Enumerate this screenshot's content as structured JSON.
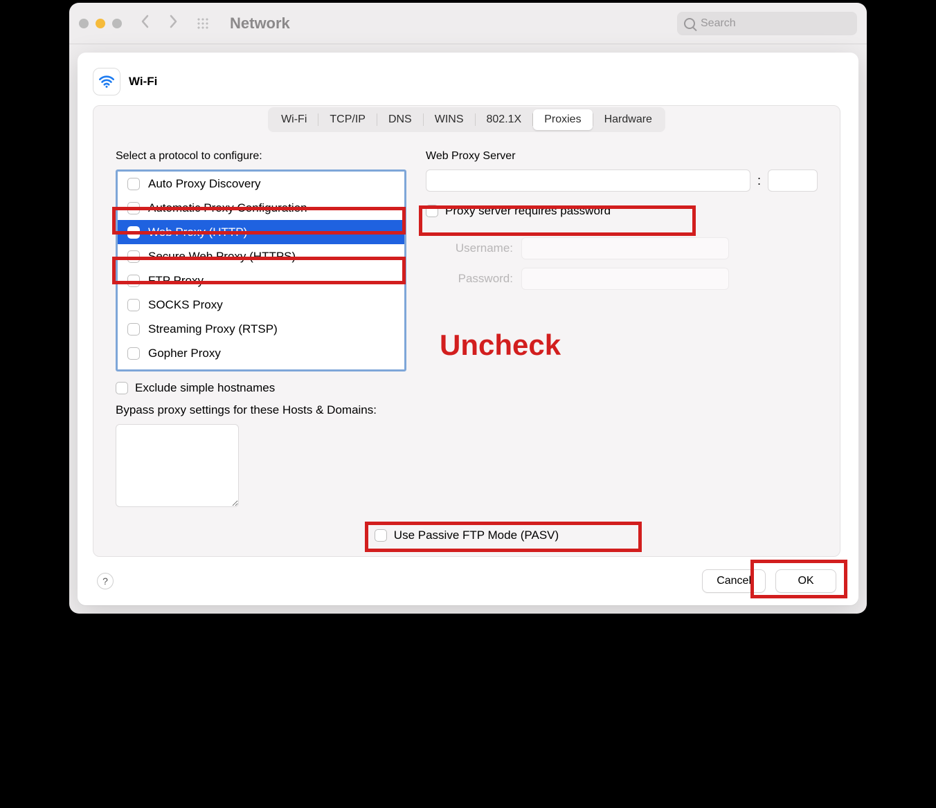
{
  "toolbar": {
    "title": "Network",
    "search_placeholder": "Search"
  },
  "sheet": {
    "title": "Wi-Fi",
    "tabs": [
      "Wi-Fi",
      "TCP/IP",
      "DNS",
      "WINS",
      "802.1X",
      "Proxies",
      "Hardware"
    ],
    "active_tab_index": 5
  },
  "left": {
    "label": "Select a protocol to configure:",
    "protocols": [
      {
        "label": "Auto Proxy Discovery",
        "checked": false,
        "selected": false
      },
      {
        "label": "Automatic Proxy Configuration",
        "checked": false,
        "selected": false
      },
      {
        "label": "Web Proxy (HTTP)",
        "checked": false,
        "selected": true
      },
      {
        "label": "Secure Web Proxy (HTTPS)",
        "checked": false,
        "selected": false
      },
      {
        "label": "FTP Proxy",
        "checked": false,
        "selected": false
      },
      {
        "label": "SOCKS Proxy",
        "checked": false,
        "selected": false
      },
      {
        "label": "Streaming Proxy (RTSP)",
        "checked": false,
        "selected": false
      },
      {
        "label": "Gopher Proxy",
        "checked": false,
        "selected": false
      }
    ],
    "exclude_simple_label": "Exclude simple hostnames"
  },
  "right": {
    "server_label": "Web Proxy Server",
    "server_host": "",
    "server_port": "",
    "requires_pw_label": "Proxy server requires password",
    "username_label": "Username:",
    "password_label": "Password:"
  },
  "bypass_label": "Bypass proxy settings for these Hosts & Domains:",
  "bypass_value": "",
  "pasv_label": "Use Passive FTP Mode (PASV)",
  "buttons": {
    "cancel": "Cancel",
    "ok": "OK"
  },
  "annotations": {
    "uncheck": "Uncheck"
  }
}
